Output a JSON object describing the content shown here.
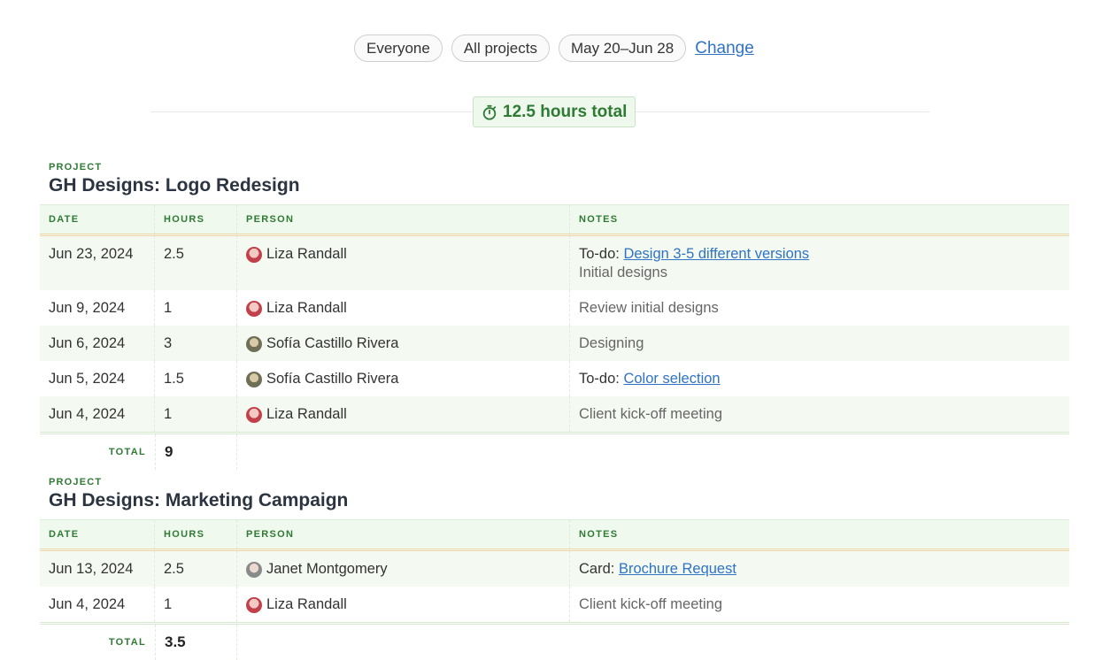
{
  "filters": {
    "people": "Everyone",
    "projects": "All projects",
    "date_range": "May 20–Jun 28",
    "change_label": "Change"
  },
  "summary": {
    "total_label": "12.5 hours total",
    "icon": "stopwatch-icon",
    "accent": "#2f7a35"
  },
  "columns": {
    "date": "DATE",
    "hours": "HOURS",
    "person": "PERSON",
    "notes": "NOTES"
  },
  "projects": [
    {
      "label": "PROJECT",
      "title": "GH Designs: Logo Redesign",
      "rows": [
        {
          "date": "Jun 23, 2024",
          "hours": "2.5",
          "person": "Liza Randall",
          "note_prefix": "To-do: ",
          "note_link": "Design 3-5 different versions",
          "note_sub": "Initial designs"
        },
        {
          "date": "Jun 9, 2024",
          "hours": "1",
          "person": "Liza Randall",
          "note": "Review initial designs"
        },
        {
          "date": "Jun 6, 2024",
          "hours": "3",
          "person": "Sofía Castillo Rivera",
          "note": "Designing"
        },
        {
          "date": "Jun 5, 2024",
          "hours": "1.5",
          "person": "Sofía Castillo Rivera",
          "note_prefix": "To-do: ",
          "note_link": "Color selection"
        },
        {
          "date": "Jun 4, 2024",
          "hours": "1",
          "person": "Liza Randall",
          "note": "Client kick-off meeting"
        }
      ],
      "total_label": "TOTAL",
      "total": "9"
    },
    {
      "label": "PROJECT",
      "title": "GH Designs: Marketing Campaign",
      "rows": [
        {
          "date": "Jun 13, 2024",
          "hours": "2.5",
          "person": "Janet Montgomery",
          "note_prefix": "Card: ",
          "note_link": "Brochure Request"
        },
        {
          "date": "Jun 4, 2024",
          "hours": "1",
          "person": "Liza Randall",
          "note": "Client kick-off meeting"
        }
      ],
      "total_label": "TOTAL",
      "total": "3.5"
    }
  ]
}
